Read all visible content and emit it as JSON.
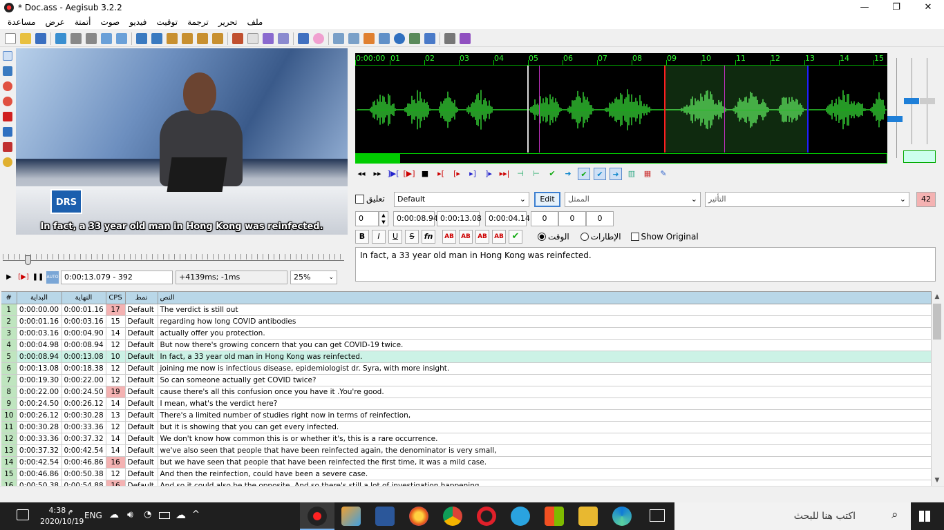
{
  "window": {
    "title": "* Doc.ass - Aegisub 3.2.2",
    "controls": [
      "—",
      "❐",
      "✕"
    ]
  },
  "menu": [
    "ملف",
    "تحرير",
    "ترجمة",
    "توقيت",
    "فيديو",
    "صوت",
    "أتمتة",
    "عرض",
    "مساعدة"
  ],
  "video": {
    "subtitle_overlay": "In fact, a 33 year old man in Hong Kong was reinfected.",
    "logo_text": "DRS",
    "time_frame": "0:00:13.079 - 392",
    "offset": "+4139ms; -1ms",
    "zoom": "25%"
  },
  "audio": {
    "ruler_labels": [
      "0:00:00",
      "01",
      "02",
      "03",
      "04",
      "05",
      "06",
      "07",
      "08",
      "09",
      "10",
      "11",
      "12",
      "13",
      "14",
      "15"
    ],
    "colors": {
      "wave": "#2fbf2f",
      "selection_start": "#ff2020",
      "selection_end": "#2020ff",
      "marker": "#c030c0"
    }
  },
  "editor": {
    "comment_label": "تعليق",
    "style_value": "Default",
    "edit_button": "Edit",
    "actor_placeholder": "الممثل",
    "effect_placeholder": "التأثير",
    "char_count": "42",
    "layer": "0",
    "start_time": "0:00:08.94",
    "end_time": "0:00:13.08",
    "duration": "0:00:04.14",
    "margin_l": "0",
    "margin_r": "0",
    "margin_v": "0",
    "format_buttons": [
      "B",
      "I",
      "U",
      "S",
      "fn",
      "AB",
      "AB",
      "AB",
      "AB"
    ],
    "radio_time": "الوقت",
    "radio_frames": "الإطارات",
    "show_original": "Show Original",
    "text": "In fact, a 33 year old man in Hong Kong was reinfected."
  },
  "grid": {
    "headers": [
      "#",
      "البداية",
      "النهاية",
      "CPS",
      "نمط",
      "النص"
    ],
    "rows": [
      {
        "n": "1",
        "start": "0:00:00.00",
        "end": "0:00:01.16",
        "cps": "17",
        "style": "Default",
        "text": "The verdict is still out",
        "warn": true
      },
      {
        "n": "2",
        "start": "0:00:01.16",
        "end": "0:00:03.16",
        "cps": "15",
        "style": "Default",
        "text": "regarding how long COVID antibodies",
        "warn": false
      },
      {
        "n": "3",
        "start": "0:00:03.16",
        "end": "0:00:04.90",
        "cps": "14",
        "style": "Default",
        "text": "actually offer you protection.",
        "warn": false
      },
      {
        "n": "4",
        "start": "0:00:04.98",
        "end": "0:00:08.94",
        "cps": "12",
        "style": "Default",
        "text": "But now there's growing concern that you can get COVID-19 twice.",
        "warn": false
      },
      {
        "n": "5",
        "start": "0:00:08.94",
        "end": "0:00:13.08",
        "cps": "10",
        "style": "Default",
        "text": " In fact, a 33 year old man in Hong Kong was reinfected.",
        "warn": false,
        "active": true
      },
      {
        "n": "6",
        "start": "0:00:13.08",
        "end": "0:00:18.38",
        "cps": "12",
        "style": "Default",
        "text": " joining me now is infectious disease, epidemiologist dr. Syra, with more insight.",
        "warn": false
      },
      {
        "n": "7",
        "start": "0:00:19.30",
        "end": "0:00:22.00",
        "cps": "12",
        "style": "Default",
        "text": "So can someone actually get COVID twice?",
        "warn": false
      },
      {
        "n": "8",
        "start": "0:00:22.00",
        "end": "0:00:24.50",
        "cps": "19",
        "style": "Default",
        "text": "cause there's all this confusion once you have it .You're good.",
        "warn": true
      },
      {
        "n": "9",
        "start": "0:00:24.50",
        "end": "0:00:26.12",
        "cps": "14",
        "style": "Default",
        "text": "I mean, what's the verdict here?",
        "warn": false
      },
      {
        "n": "10",
        "start": "0:00:26.12",
        "end": "0:00:30.28",
        "cps": "13",
        "style": "Default",
        "text": "There's a limited number of studies right now in terms of reinfection,",
        "warn": false
      },
      {
        "n": "11",
        "start": "0:00:30.28",
        "end": "0:00:33.36",
        "cps": "12",
        "style": "Default",
        "text": " but it is showing that you can get every infected.",
        "warn": false
      },
      {
        "n": "12",
        "start": "0:00:33.36",
        "end": "0:00:37.32",
        "cps": "14",
        "style": "Default",
        "text": "We don't know how common this is or whether it's, this is a rare occurrence.",
        "warn": false
      },
      {
        "n": "13",
        "start": "0:00:37.32",
        "end": "0:00:42.54",
        "cps": "14",
        "style": "Default",
        "text": "we've also seen that people that have been reinfected again, the denominator is very small,",
        "warn": false
      },
      {
        "n": "14",
        "start": "0:00:42.54",
        "end": "0:00:46.86",
        "cps": "16",
        "style": "Default",
        "text": " but we have seen that people that have been reinfected the first time, it was a mild case.",
        "warn": true
      },
      {
        "n": "15",
        "start": "0:00:46.86",
        "end": "0:00:50.38",
        "cps": "12",
        "style": "Default",
        "text": "And then the reinfection, could have been a severe case.",
        "warn": false
      },
      {
        "n": "16",
        "start": "0:00:50.38",
        "end": "0:00:54.88",
        "cps": "16",
        "style": "Default",
        "text": " And so it could also be the opposite. And so there's still a lot of investigation happening",
        "warn": true
      }
    ]
  },
  "taskbar": {
    "time": "4:38 م",
    "date": "2020/10/19",
    "lang": "ENG",
    "search_placeholder": "اكتب هنا للبحث"
  }
}
